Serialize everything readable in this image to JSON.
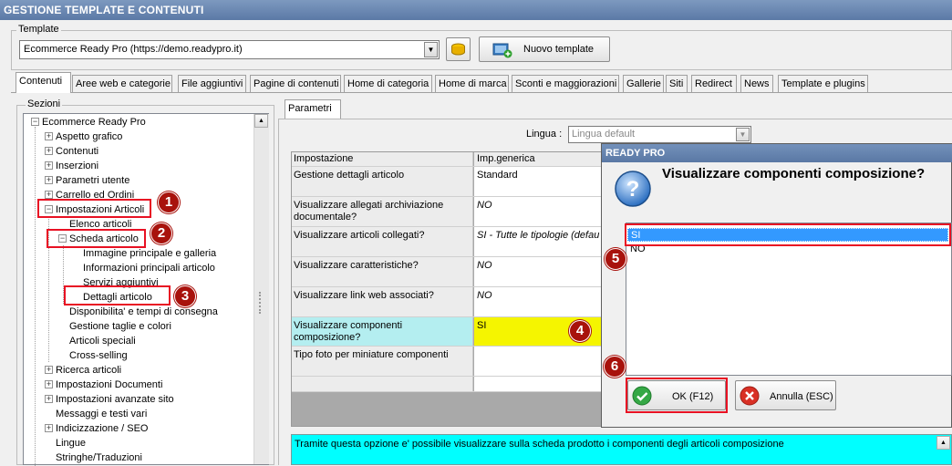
{
  "window": {
    "title": "GESTIONE TEMPLATE E CONTENUTI"
  },
  "template": {
    "group_label": "Template",
    "selected": "Ecommerce Ready Pro (https://demo.readypro.it)",
    "new_button": "Nuovo template"
  },
  "tabs": [
    "Contenuti",
    "Aree web e categorie",
    "File aggiuntivi",
    "Pagine di contenuti",
    "Home di categoria",
    "Home di marca",
    "Sconti e maggiorazioni",
    "Gallerie",
    "Siti",
    "Redirect",
    "News",
    "Template e plugins"
  ],
  "sections": {
    "label": "Sezioni",
    "root": "Ecommerce Ready Pro",
    "items": [
      "Aspetto grafico",
      "Contenuti",
      "Inserzioni",
      "Parametri utente",
      "Carrello ed Ordini",
      "Impostazioni Articoli",
      "Elenco articoli",
      "Scheda articolo",
      "Immagine principale e galleria",
      "Informazioni principali articolo",
      "Servizi aggiuntivi",
      "Dettagli articolo",
      "Disponibilita' e tempi di consegna",
      "Gestione taglie e colori",
      "Articoli speciali",
      "Cross-selling",
      "Ricerca articoli",
      "Impostazioni Documenti",
      "Impostazioni avanzate sito",
      "Messaggi e testi vari",
      "Indicizzazione / SEO",
      "Lingue",
      "Stringhe/Traduzioni"
    ]
  },
  "params": {
    "tab": "Parametri",
    "lingua_label": "Lingua :",
    "lingua_value": "Lingua default",
    "col_setting": "Impostazione",
    "col_value": "Imp.generica",
    "rows": [
      {
        "setting": "Gestione dettagli articolo",
        "value": "Standard"
      },
      {
        "setting": "Visualizzare allegati archiviazione documentale?",
        "value": "NO"
      },
      {
        "setting": "Visualizzare articoli collegati?",
        "value": "SI - Tutte le tipologie (defau"
      },
      {
        "setting": "Visualizzare caratteristiche?",
        "value": "NO"
      },
      {
        "setting": "Visualizzare link web associati?",
        "value": "NO"
      },
      {
        "setting": "Visualizzare componenti composizione?",
        "value": "SI"
      },
      {
        "setting": "Tipo foto per miniature componenti",
        "value": ""
      }
    ],
    "description": "Tramite questa opzione e' possibile visualizzare sulla scheda prodotto i componenti degli articoli composizione"
  },
  "dialog": {
    "title": "READY PRO",
    "question": "Visualizzare componenti composizione?",
    "options": [
      "SI",
      "NO"
    ],
    "ok": "OK (F12)",
    "cancel": "Annulla (ESC)"
  },
  "steps": [
    "1",
    "2",
    "3",
    "4",
    "5",
    "6"
  ],
  "colors": {
    "highlight_row": "#b4eef0",
    "yellow": "#f5f500",
    "selection": "#3399ff",
    "callout": "#a8120c",
    "description_bg": "#00ffff"
  }
}
